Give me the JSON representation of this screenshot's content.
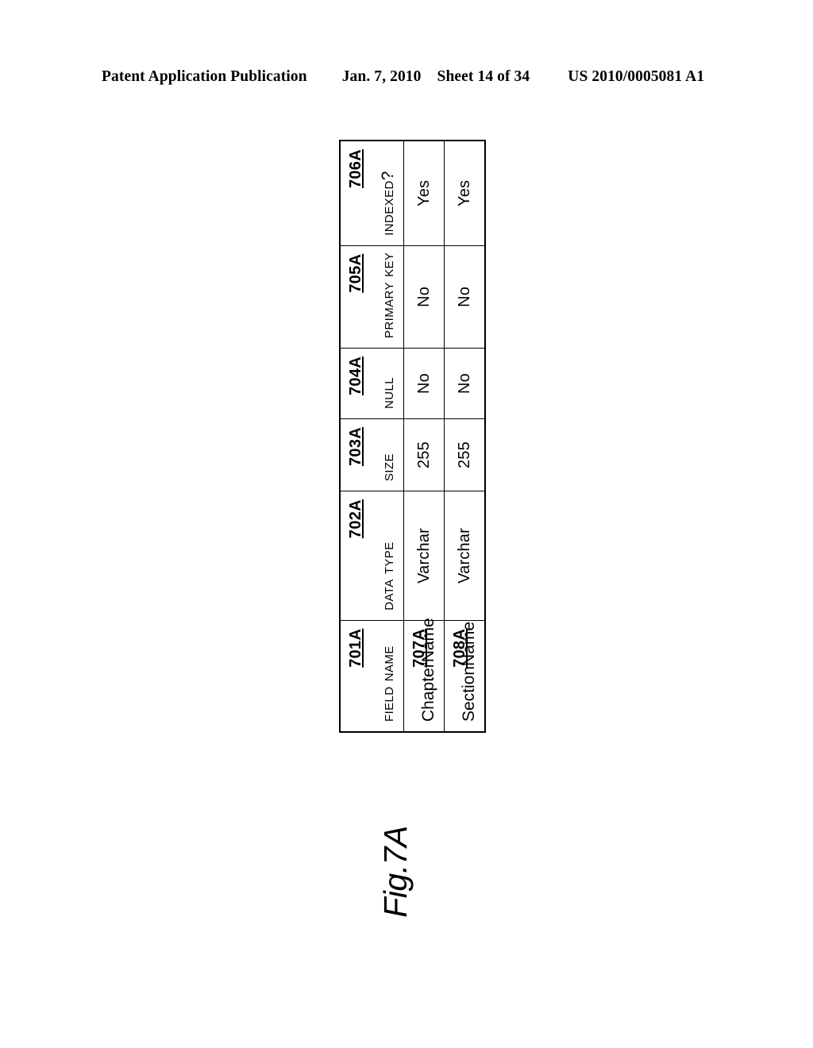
{
  "header": {
    "publication": "Patent Application Publication",
    "date": "Jan. 7, 2010",
    "sheet": "Sheet 14 of 34",
    "doc_number": "US 2010/0005081 A1"
  },
  "figure": {
    "caption": "Fig.7A"
  },
  "table": {
    "columns": [
      {
        "label": "Field Name",
        "ref": "701A",
        "style": "smallcaps"
      },
      {
        "label": "Data Type",
        "ref": "702A",
        "style": "smallcaps"
      },
      {
        "label": "Size",
        "ref": "703A",
        "style": "smallcaps"
      },
      {
        "label": "Null",
        "ref": "704A",
        "style": "smallcaps"
      },
      {
        "label": "Primary Key",
        "ref": "705A",
        "style": "smallcaps"
      },
      {
        "label": "Indexed?",
        "ref": "706A",
        "style": "smallcaps"
      }
    ],
    "rows": [
      {
        "field_name": "ChapterName",
        "field_ref": "707A",
        "data_type": "Varchar",
        "size": "255",
        "null": "No",
        "primary_key": "No",
        "indexed": "Yes"
      },
      {
        "field_name": "SectionName",
        "field_ref": "708A",
        "data_type": "Varchar",
        "size": "255",
        "null": "No",
        "primary_key": "No",
        "indexed": "Yes"
      }
    ]
  }
}
